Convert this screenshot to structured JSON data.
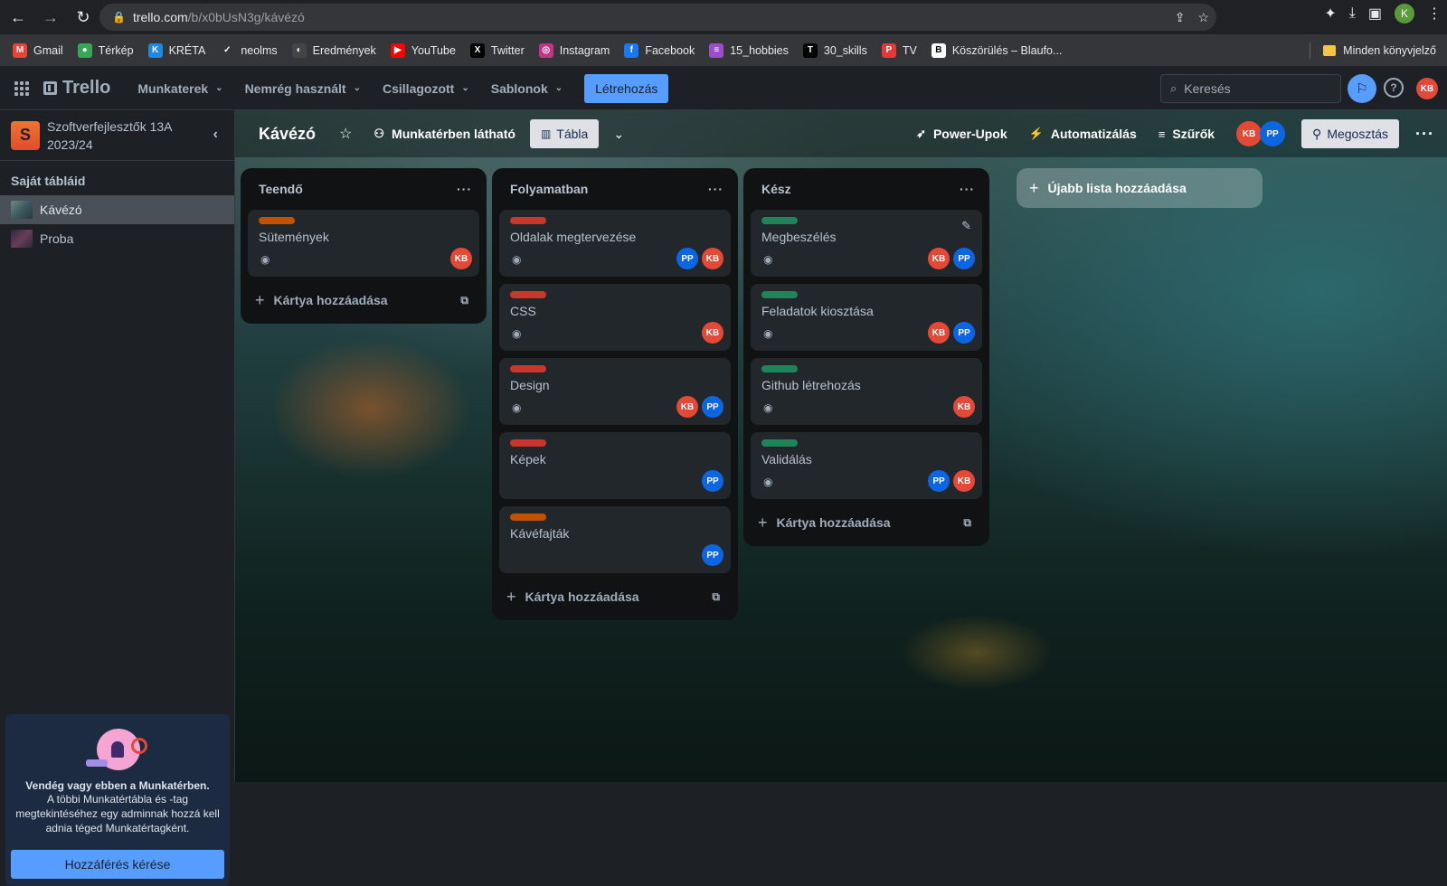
{
  "browser": {
    "url_host": "trello.com",
    "url_path": "/b/x0bUsN3g/kávézó"
  },
  "bookmarks": [
    {
      "label": "Gmail",
      "color": "#ea4335",
      "glyph": "M"
    },
    {
      "label": "Térkép",
      "color": "#34a853",
      "glyph": "●"
    },
    {
      "label": "KRÉTA",
      "color": "#1e88e5",
      "glyph": "K"
    },
    {
      "label": "neolms",
      "color": "#35363a",
      "glyph": "✓"
    },
    {
      "label": "Eredmények",
      "color": "#444",
      "glyph": "◐"
    },
    {
      "label": "YouTube",
      "color": "#ff0000",
      "glyph": "▶"
    },
    {
      "label": "Twitter",
      "color": "#000",
      "glyph": "X"
    },
    {
      "label": "Instagram",
      "color": "#c13584",
      "glyph": "◎"
    },
    {
      "label": "Facebook",
      "color": "#1877f2",
      "glyph": "f"
    },
    {
      "label": "15_hobbies",
      "color": "#9c4dcc",
      "glyph": "≡"
    },
    {
      "label": "30_skills",
      "color": "#000",
      "glyph": "T"
    },
    {
      "label": "TV",
      "color": "#e53935",
      "glyph": "P"
    },
    {
      "label": "Köszörülés – Blaufo...",
      "color": "#fff",
      "glyph": "B"
    }
  ],
  "bookmarks_all": "Minden könyvjelző",
  "trello": {
    "logo": "Trello",
    "menu": [
      "Munkaterek",
      "Nemrég használt",
      "Csillagozott",
      "Sablonok"
    ],
    "create": "Létrehozás",
    "search_placeholder": "Keresés",
    "user_initials": "KB"
  },
  "sidebar": {
    "workspace_initial": "S",
    "workspace_name": "Szoftverfejlesztők 13A 2023/24",
    "section": "Saját tábláid",
    "boards": [
      "Kávézó",
      "Proba"
    ],
    "guest_title": "Vendég vagy ebben a Munkatérben.",
    "guest_text": "A többi Munkatértábla és -tag megtekintéséhez egy adminnak hozzá kell adnia téged Munkatértagként.",
    "access_button": "Hozzáférés kérése"
  },
  "board": {
    "title": "Kávézó",
    "visibility": "Munkatérben látható",
    "view": "Tábla",
    "powerups": "Power-Upok",
    "automation": "Automatizálás",
    "filters": "Szűrők",
    "members": [
      "KB",
      "PP"
    ],
    "share": "Megosztás",
    "add_card": "Kártya hozzáadása",
    "new_list": "Újabb lista hozzáadása"
  },
  "lists": [
    {
      "title": "Teendő",
      "cards": [
        {
          "title": "Sütemények",
          "label": "#c25100",
          "members": [
            "KB"
          ],
          "eye": true
        }
      ]
    },
    {
      "title": "Folyamatban",
      "cards": [
        {
          "title": "Oldalak megtervezése",
          "label": "#c9372c",
          "members": [
            "PP",
            "KB"
          ],
          "eye": true
        },
        {
          "title": "CSS",
          "label": "#c9372c",
          "members": [
            "KB"
          ],
          "eye": true
        },
        {
          "title": "Design",
          "label": "#c9372c",
          "members": [
            "KB",
            "PP"
          ],
          "eye": true
        },
        {
          "title": "Képek",
          "label": "#c9372c",
          "members": [
            "PP"
          ],
          "eye": false
        },
        {
          "title": "Kávéfajták",
          "label": "#c25100",
          "members": [
            "PP"
          ],
          "eye": false
        }
      ]
    },
    {
      "title": "Kész",
      "cards": [
        {
          "title": "Megbeszélés",
          "label": "#1f845a",
          "members": [
            "KB",
            "PP"
          ],
          "eye": true,
          "edit": true
        },
        {
          "title": "Feladatok kiosztása",
          "label": "#1f845a",
          "members": [
            "KB",
            "PP"
          ],
          "eye": true
        },
        {
          "title": "Github létrehozás",
          "label": "#1f845a",
          "members": [
            "KB"
          ],
          "eye": true
        },
        {
          "title": "Validálás",
          "label": "#1f845a",
          "members": [
            "PP",
            "KB"
          ],
          "eye": true
        }
      ]
    }
  ]
}
